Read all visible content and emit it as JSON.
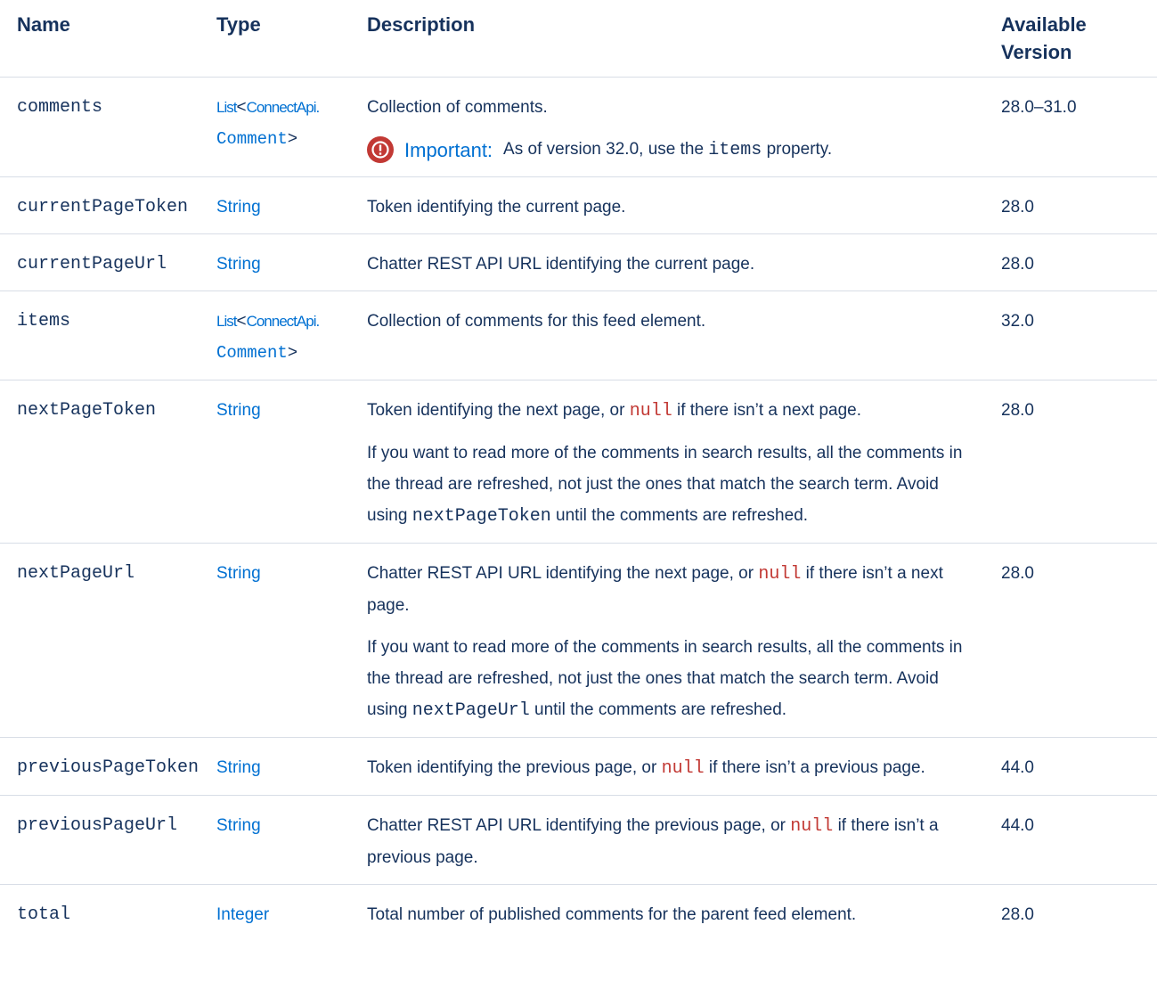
{
  "headers": {
    "name": "Name",
    "type": "Type",
    "description": "Description",
    "version_line1": "Available",
    "version_line2": "Version"
  },
  "rows": {
    "comments": {
      "name": "comments",
      "type_list": "List",
      "type_open": "<",
      "type_ns": "ConnectApi.",
      "type_class": "Comment",
      "type_close": ">",
      "desc": "Collection of comments.",
      "important_label": "Important:",
      "important_pre": "As of version 32.0, use the",
      "important_code": "items",
      "important_post": "property.",
      "version": "28.0–31.0"
    },
    "currentPageToken": {
      "name": "currentPageToken",
      "type": "String",
      "desc": "Token identifying the current page.",
      "version": "28.0"
    },
    "currentPageUrl": {
      "name": "currentPageUrl",
      "type": "String",
      "desc": "Chatter REST API URL identifying the current page.",
      "version": "28.0"
    },
    "items": {
      "name": "items",
      "type_list": "List",
      "type_open": "<",
      "type_ns": "ConnectApi.",
      "type_class": "Comment",
      "type_close": ">",
      "desc": "Collection of comments for this feed element.",
      "version": "32.0"
    },
    "nextPageToken": {
      "name": "nextPageToken",
      "type": "String",
      "desc1_pre": "Token identifying the next page, or",
      "desc1_null": "null",
      "desc1_post": "if there isn’t a next page.",
      "desc2_pre": "If you want to read more of the comments in search results, all the comments in the thread are refreshed, not just the ones that match the search term. Avoid using",
      "desc2_code": "nextPageToken",
      "desc2_post": "until the comments are refreshed.",
      "version": "28.0"
    },
    "nextPageUrl": {
      "name": "nextPageUrl",
      "type": "String",
      "desc1_pre": "Chatter REST API URL identifying the next page, or",
      "desc1_null": "null",
      "desc1_post": "if there isn’t a next page.",
      "desc2_pre": "If you want to read more of the comments in search results, all the comments in the thread are refreshed, not just the ones that match the search term. Avoid using",
      "desc2_code": "nextPageUrl",
      "desc2_post": "until the comments are refreshed.",
      "version": "28.0"
    },
    "previousPageToken": {
      "name": "previousPageToken",
      "type": "String",
      "desc_pre": "Token identifying the previous page, or",
      "desc_null": "null",
      "desc_post": "if there isn’t a previous page.",
      "version": "44.0"
    },
    "previousPageUrl": {
      "name": "previousPageUrl",
      "type": "String",
      "desc_pre": "Chatter REST API URL identifying the previous page, or",
      "desc_null": "null",
      "desc_post": "if there isn’t a previous page.",
      "version": "44.0"
    },
    "total": {
      "name": "total",
      "type": "Integer",
      "desc": "Total number of published comments for the parent feed element.",
      "version": "28.0"
    }
  },
  "colors": {
    "text": "#16325c",
    "link": "#0070d2",
    "null_code": "#c23934",
    "important_icon": "#c23934",
    "divider": "#d8dde6"
  },
  "icons": {
    "important": "exclamation-circle-icon"
  }
}
